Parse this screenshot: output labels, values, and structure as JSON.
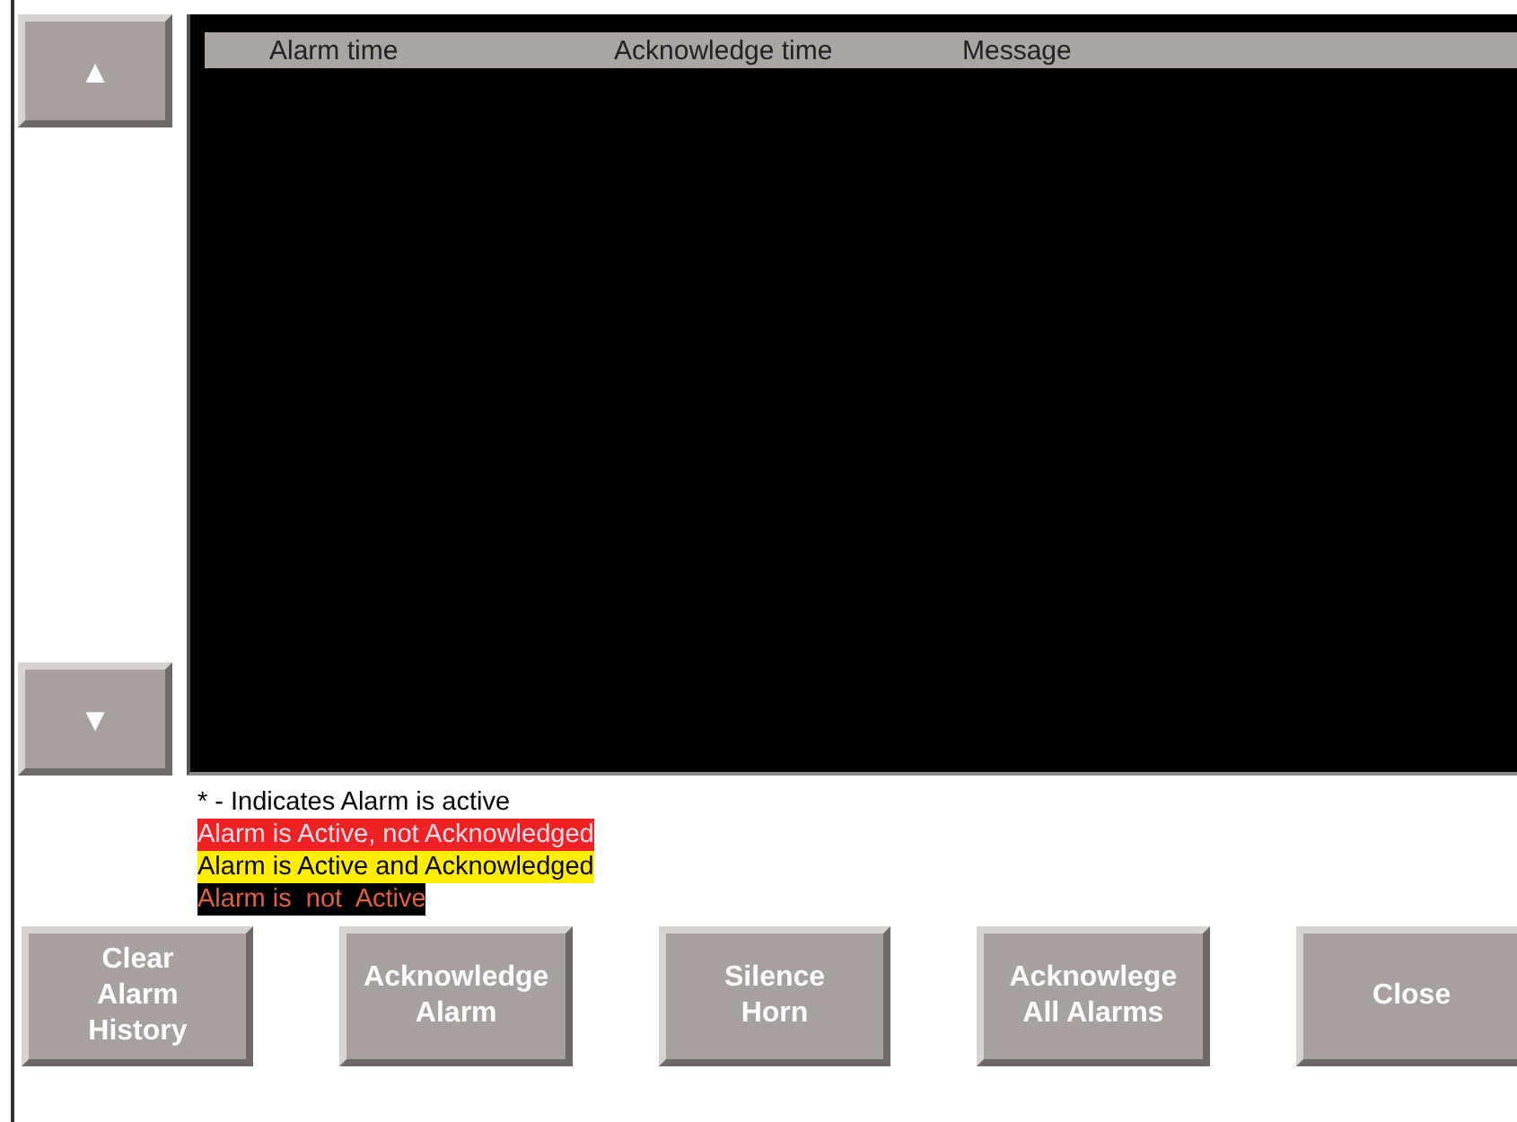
{
  "scroll_buttons": [
    {
      "kind": "up",
      "label": "▲"
    },
    {
      "kind": "down",
      "label": "▼"
    }
  ],
  "table": {
    "columns": [
      "Alarm time",
      "Acknowledge time",
      "Message"
    ]
  },
  "legend": [
    {
      "kind": "note",
      "text": "* - Indicates Alarm is active"
    },
    {
      "kind": "unacked",
      "text": "Alarm is Active, not Acknowledged"
    },
    {
      "kind": "acked",
      "text": "Alarm is Active and Acknowledged"
    },
    {
      "kind": "inactive",
      "text": "Alarm is  not  Active"
    }
  ],
  "buttons": [
    [
      "Clear",
      "Alarm",
      "History"
    ],
    [
      "Acknowledge",
      "Alarm"
    ],
    [
      "Silence",
      "Horn"
    ],
    [
      "Acknowlege",
      "All Alarms"
    ],
    [
      "Close"
    ]
  ]
}
